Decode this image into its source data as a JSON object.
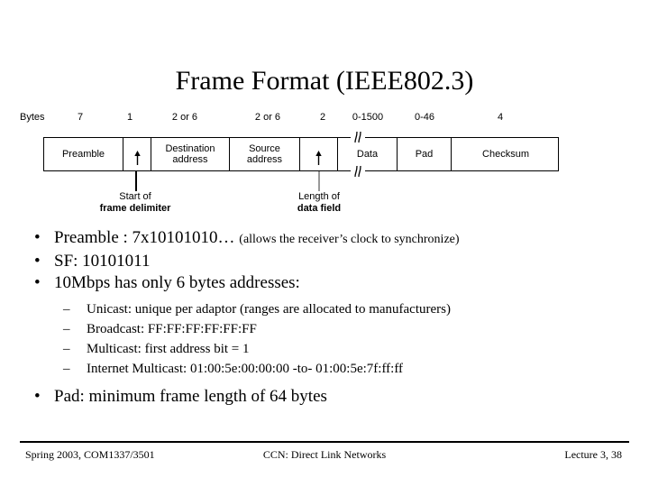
{
  "slide": {
    "title": "Frame Format (IEEE802.3)",
    "colors": {
      "text": "#000000",
      "background": "#ffffff",
      "rule": "#000000"
    }
  },
  "diagram": {
    "bytes_word": "Bytes",
    "size_labels": [
      "7",
      "1",
      "2 or 6",
      "2 or 6",
      "2",
      "0-1500",
      "0-46",
      "4"
    ],
    "fields": [
      {
        "line1": "Preamble",
        "line2": ""
      },
      {
        "line1": "",
        "line2": ""
      },
      {
        "line1": "Destination",
        "line2": "address"
      },
      {
        "line1": "Source",
        "line2": "address"
      },
      {
        "line1": "",
        "line2": ""
      },
      {
        "line1": "Data",
        "line2": ""
      },
      {
        "line1": "Pad",
        "line2": ""
      },
      {
        "line1": "Checksum",
        "line2": ""
      }
    ],
    "callouts": [
      {
        "line1": "Start of",
        "line2": "frame delimiter"
      },
      {
        "line1": "Length of",
        "line2": "data field"
      }
    ]
  },
  "bullets": [
    {
      "marker": "•",
      "text": "Preamble : 7x10101010… ",
      "note": "(allows the receiver’s clock to synchronize)"
    },
    {
      "marker": "•",
      "text": "SF: 10101011",
      "note": ""
    },
    {
      "marker": "•",
      "text": "10Mbps has only 6 bytes addresses:",
      "note": ""
    }
  ],
  "sub_bullets": [
    {
      "marker": "–",
      "text": "Unicast: unique per adaptor (ranges are allocated to manufacturers)"
    },
    {
      "marker": "–",
      "text": "Broadcast: FF:FF:FF:FF:FF:FF"
    },
    {
      "marker": "–",
      "text": "Multicast: first address bit = 1"
    },
    {
      "marker": "–",
      "text": "Internet Multicast: 01:00:5e:00:00:00 -to- 01:00:5e:7f:ff:ff"
    }
  ],
  "last_bullet": {
    "marker": "•",
    "text": "Pad: minimum frame length of 64 bytes"
  },
  "footer": {
    "left": "Spring 2003, COM1337/3501",
    "center": "CCN: Direct Link Networks",
    "right": "Lecture 3, 38"
  }
}
